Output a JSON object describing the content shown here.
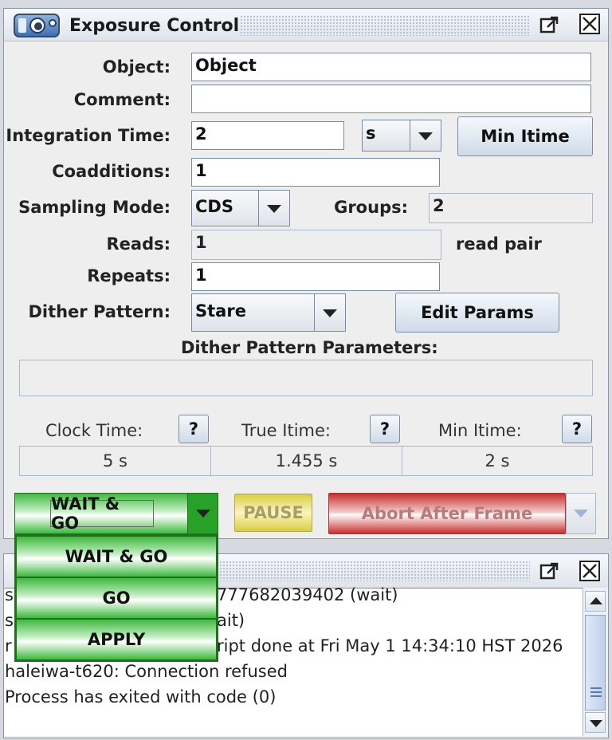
{
  "exposure": {
    "title": "Exposure Control",
    "object_label": "Object:",
    "object_value": "Object",
    "comment_label": "Comment:",
    "comment_value": "",
    "itime_label": "Integration Time:",
    "itime_value": "2",
    "itime_unit": "s",
    "min_itime_button": "Min Itime",
    "coadds_label": "Coadditions:",
    "coadds_value": "1",
    "sampling_label": "Sampling Mode:",
    "sampling_value": "CDS",
    "groups_label": "Groups:",
    "groups_value": "2",
    "reads_label": "Reads:",
    "reads_value": "1",
    "reads_unit": "read pair",
    "repeats_label": "Repeats:",
    "repeats_value": "1",
    "dither_label": "Dither Pattern:",
    "dither_value": "Stare",
    "edit_params_button": "Edit Params",
    "dither_params_label": "Dither Pattern Parameters:",
    "dither_params_value": "",
    "clock_time_label": "Clock Time:",
    "clock_time_value": "5 s",
    "true_itime_label": "True Itime:",
    "true_itime_value": "1.455 s",
    "min_itime_label": "Min Itime:",
    "min_itime_value": "2 s",
    "help_button": "?"
  },
  "actions": {
    "go_mode_selected": "WAIT & GO",
    "pause_button": "PAUSE",
    "abort_button": "Abort After Frame",
    "go_menu": [
      "WAIT & GO",
      "GO",
      "APPLY"
    ]
  },
  "log": {
    "lines": [
      "s",
      "s",
      "r",
      "haleiwa-t620: Connection refused",
      "Process has exited with code (0)"
    ],
    "partial_right": [
      "777682039402 (wait)",
      "ait)",
      "ript done at Fri May  1 14:34:10 HST 2026"
    ]
  },
  "colors": {
    "green": "#3fb83f",
    "abort_red": "#d63a3a",
    "pause_yellow": "#e8dd7a",
    "border_blue": "#7a8aa6"
  }
}
